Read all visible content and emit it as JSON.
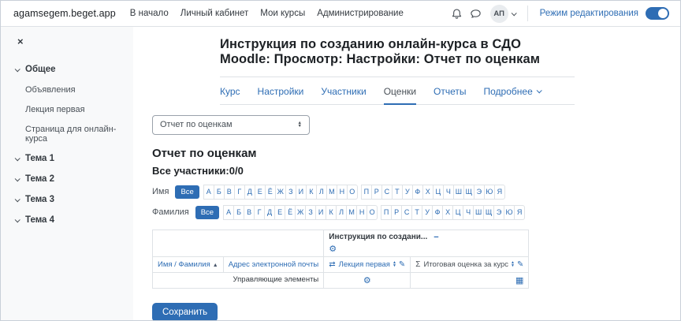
{
  "topbar": {
    "site_name": "agamsegem.beget.app",
    "nav_items": [
      "В начало",
      "Личный кабинет",
      "Мои курсы",
      "Администрирование"
    ],
    "avatar_initials": "АП",
    "edit_mode_label": "Режим редактирования",
    "edit_mode_on": true
  },
  "sidebar": {
    "items": [
      {
        "label": "Общее",
        "kind": "section"
      },
      {
        "label": "Объявления",
        "kind": "link"
      },
      {
        "label": "Лекция первая",
        "kind": "link"
      },
      {
        "label": "Страница для онлайн-курса",
        "kind": "link"
      },
      {
        "label": "Тема 1",
        "kind": "section"
      },
      {
        "label": "Тема 2",
        "kind": "section"
      },
      {
        "label": "Тема 3",
        "kind": "section"
      },
      {
        "label": "Тема 4",
        "kind": "section"
      }
    ]
  },
  "header": {
    "course_title": "Инструкция по созданию онлайн-курса в СДО Moodle: Просмотр: Настройки: Отчет по оценкам",
    "tabs": [
      {
        "label": "Курс"
      },
      {
        "label": "Настройки"
      },
      {
        "label": "Участники"
      },
      {
        "label": "Оценки",
        "active": true
      },
      {
        "label": "Отчеты"
      },
      {
        "label": "Подробнее",
        "kind": "menu"
      }
    ]
  },
  "content": {
    "report_select_value": "Отчет по оценкам",
    "heading": "Отчет по оценкам",
    "participants_heading": "Все участники:0/0",
    "filters": {
      "first_name_label": "Имя",
      "last_name_label": "Фамилия",
      "all_label": "Все",
      "letters_group1": [
        "А",
        "Б",
        "В",
        "Г",
        "Д",
        "Е",
        "Ё",
        "Ж",
        "З",
        "И",
        "К",
        "Л",
        "М",
        "Н",
        "О"
      ],
      "letters_group2": [
        "П",
        "Р",
        "С",
        "Т",
        "У",
        "Ф",
        "Х",
        "Ц",
        "Ч",
        "Ш",
        "Щ",
        "Э",
        "Ю",
        "Я"
      ]
    },
    "grader_table": {
      "course_column_header": "Инструкция по создани...",
      "name_column": "Имя / Фамилия",
      "email_column": "Адрес электронной почты",
      "activity_column": "Лекция первая",
      "total_sigma": "Σ",
      "total_column": "Итоговая оценка за курс",
      "controls_row_label": "Управляющие элементы"
    },
    "save_button_label": "Сохранить"
  },
  "colors": {
    "primary_blue": "#2e6db4",
    "sidebar_background": "#f8f9fa",
    "border_gray": "#dee2e6"
  }
}
